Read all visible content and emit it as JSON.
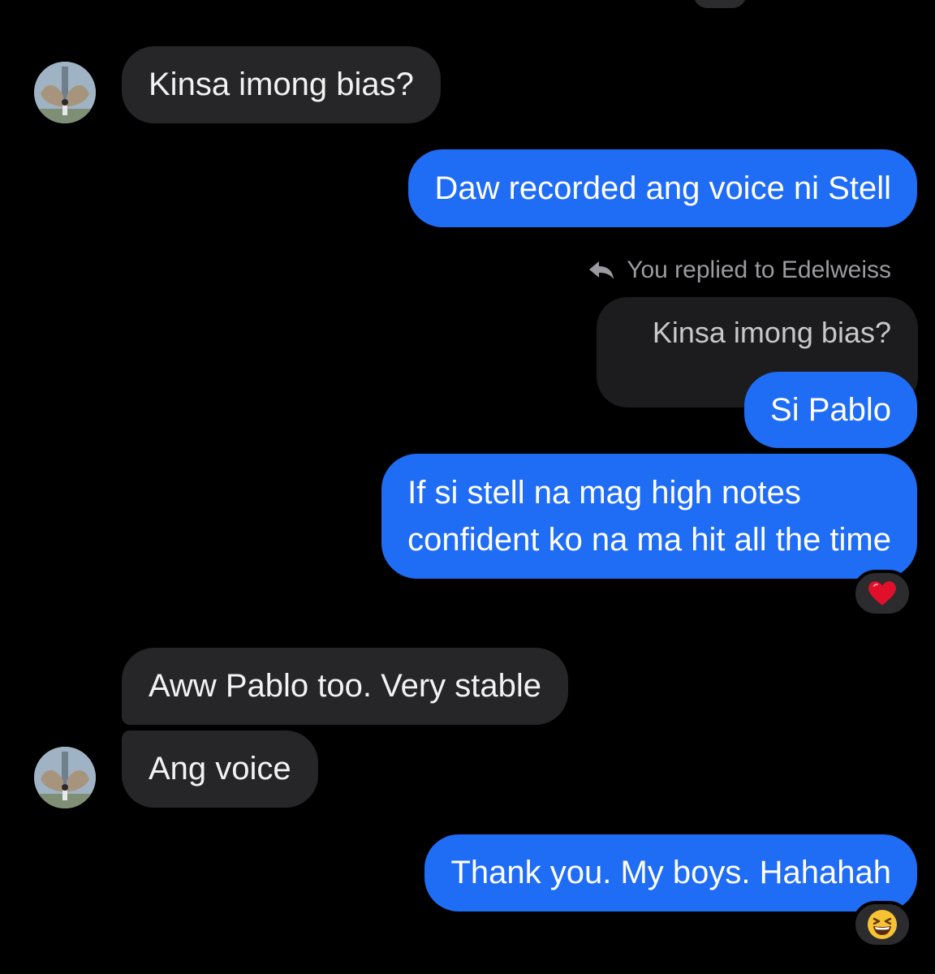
{
  "conversation": {
    "messages": [
      {
        "side": "in",
        "text": "Kinsa imong bias?"
      },
      {
        "side": "out",
        "text": "Daw recorded ang voice ni Stell"
      },
      {
        "side": "out",
        "reply_label": "You replied to Edelweiss",
        "quoted_text": "Kinsa imong bias?",
        "text": "Si Pablo"
      },
      {
        "side": "out",
        "text_line1": "If si stell na mag high notes",
        "text_line2": "confident ko na ma hit all the time",
        "reaction": "heart"
      },
      {
        "side": "in",
        "text": "Aww Pablo too. Very stable"
      },
      {
        "side": "in",
        "text": "Ang voice"
      },
      {
        "side": "out",
        "text": "Thank you. My boys. Hahahah",
        "reaction": "grinning-squinting-face"
      }
    ]
  },
  "colors": {
    "background": "#000000",
    "incoming_bubble": "#262628",
    "outgoing_bubble": "#1f6cf5",
    "heart": "#e0102a"
  }
}
